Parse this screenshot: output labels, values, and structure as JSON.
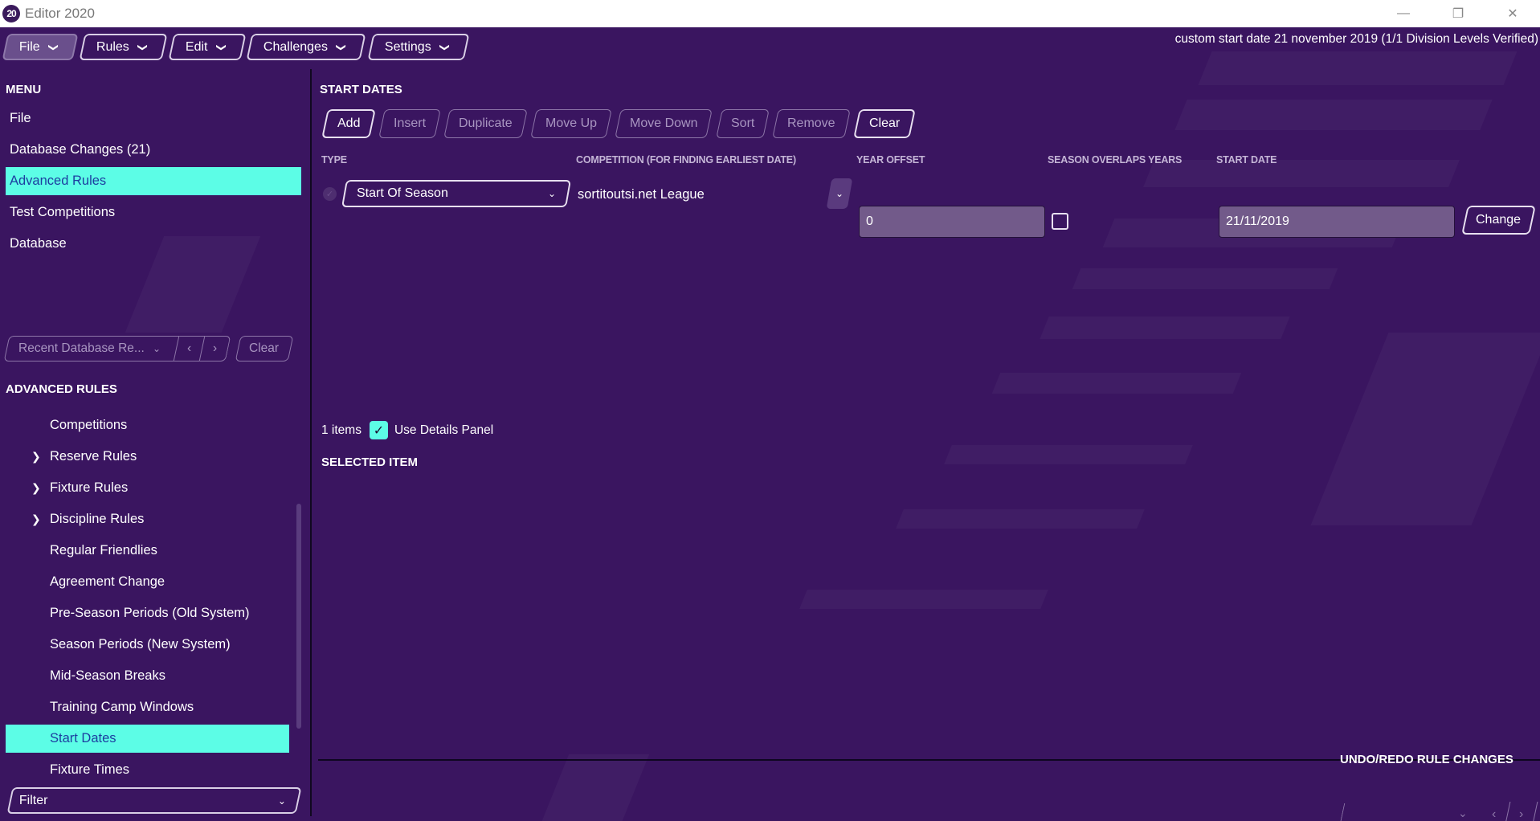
{
  "window": {
    "logo_text": "20",
    "title": "Editor 2020",
    "controls": {
      "minimize": "—",
      "restore": "❐",
      "close": "✕"
    }
  },
  "menubar": {
    "items": [
      {
        "label": "File",
        "active": true
      },
      {
        "label": "Rules",
        "active": false
      },
      {
        "label": "Edit",
        "active": false
      },
      {
        "label": "Challenges",
        "active": false
      },
      {
        "label": "Settings",
        "active": false
      }
    ],
    "status": "custom start date 21 november 2019 (1/1 Division Levels Verified)"
  },
  "sidebar": {
    "menu_title": "MENU",
    "menu_items": [
      {
        "label": "File",
        "selected": false
      },
      {
        "label": "Database Changes (21)",
        "selected": false
      },
      {
        "label": "Advanced Rules",
        "selected": true
      },
      {
        "label": "Test Competitions",
        "selected": false
      },
      {
        "label": "Database",
        "selected": false
      }
    ],
    "recent": {
      "placeholder": "Recent Database Re...",
      "prev": "‹",
      "next": "›",
      "clear_label": "Clear"
    },
    "advanced_title": "ADVANCED RULES",
    "tree_items": [
      {
        "label": "Competitions",
        "expandable": false,
        "selected": false
      },
      {
        "label": "Reserve Rules",
        "expandable": true,
        "selected": false
      },
      {
        "label": "Fixture Rules",
        "expandable": true,
        "selected": false
      },
      {
        "label": "Discipline Rules",
        "expandable": true,
        "selected": false
      },
      {
        "label": "Regular Friendlies",
        "expandable": false,
        "selected": false
      },
      {
        "label": "Agreement Change",
        "expandable": false,
        "selected": false
      },
      {
        "label": "Pre-Season Periods (Old System)",
        "expandable": false,
        "selected": false
      },
      {
        "label": "Season Periods (New System)",
        "expandable": false,
        "selected": false
      },
      {
        "label": "Mid-Season Breaks",
        "expandable": false,
        "selected": false
      },
      {
        "label": "Training Camp Windows",
        "expandable": false,
        "selected": false
      },
      {
        "label": "Start Dates",
        "expandable": false,
        "selected": true
      },
      {
        "label": "Fixture Times",
        "expandable": false,
        "selected": false
      }
    ],
    "filter_label": "Filter"
  },
  "content": {
    "title": "START DATES",
    "toolbar": [
      {
        "label": "Add",
        "enabled": true
      },
      {
        "label": "Insert",
        "enabled": false
      },
      {
        "label": "Duplicate",
        "enabled": false
      },
      {
        "label": "Move Up",
        "enabled": false
      },
      {
        "label": "Move Down",
        "enabled": false
      },
      {
        "label": "Sort",
        "enabled": false
      },
      {
        "label": "Remove",
        "enabled": false
      },
      {
        "label": "Clear",
        "enabled": true
      }
    ],
    "columns": {
      "type": "TYPE",
      "competition": "COMPETITION (FOR FINDING EARLIEST DATE)",
      "year_offset": "YEAR OFFSET",
      "overlaps": "SEASON OVERLAPS YEARS",
      "start_date": "START DATE"
    },
    "row": {
      "type": "Start Of Season",
      "competition": "sortitoutsi.net League",
      "year_offset": "0",
      "season_overlaps_years": false,
      "start_date": "21/11/2019",
      "change_label": "Change"
    },
    "items_count": "1 items",
    "use_details_label": "Use Details Panel",
    "use_details_checked": true,
    "selected_item_title": "SELECTED ITEM"
  },
  "undo": {
    "title": "UNDO/REDO RULE CHANGES",
    "prev": "‹",
    "next": "›"
  },
  "colors": {
    "background": "#3a1560",
    "accent": "#5cfde6",
    "selected_text": "#1d3ea0",
    "field_bg": "#725a8a"
  }
}
